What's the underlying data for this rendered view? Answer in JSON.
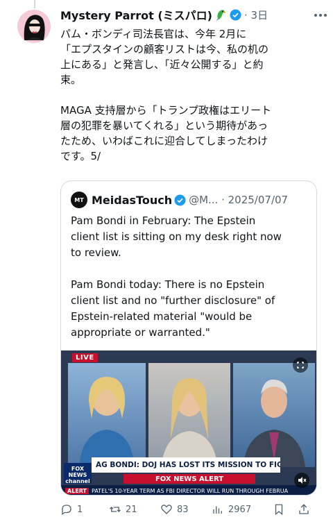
{
  "tweet": {
    "display_name": "Mystery Parrot (ミスパロ)",
    "time": "3日",
    "text": "パム・ボンディ司法長官は、今年 2月に\n「エプスタインの顧客リストは今、私の机の\n上にある」と発言し、「近々公開する」と約\n束。\n\nMAGA 支持層から「トランプ政権はエリート\n層の犯罪を暴いてくれる」という期待があっ\nたため、いわばこれに迎合してしまったわけ\nです。5/"
  },
  "quote": {
    "avatar_text": "MT",
    "display_name": "MeidasTouch",
    "meta": "@M... · 2025/07/07",
    "text": "Pam Bondi in February: The Epstein\nclient list is sitting on my desk right now\nto review.\n\nPam Bondi today: There is no Epstein\nclient list and no \"further disclosure\" of\nEpstein-related material \"would be\nappropriate or warranted.\"",
    "video": {
      "live_label": "LIVE",
      "chyron": "AG BONDI: DOJ HAS LOST ITS MISSION TO FIGHT CRIME",
      "alert_bar": "FOX NEWS ALERT",
      "ticker_alert": "ALERT",
      "ticker": "PATEL'S 10-YEAR TERM AS FBI DIRECTOR WILL RUN THROUGH FEBRUA",
      "logo": "FOX NEWS channel"
    }
  },
  "actions": {
    "replies": "1",
    "reposts": "21",
    "likes": "83",
    "views": "2967"
  },
  "colors": {
    "text": "#0f1419",
    "muted": "#536471",
    "verified": "#1d9bf0",
    "border": "#cfd9de",
    "fox_red": "#c8102e",
    "fox_navy": "#0b1f45"
  },
  "icons": [
    "parrot-icon",
    "verified-icon",
    "more-icon",
    "reply-icon",
    "repost-icon",
    "like-icon",
    "views-icon",
    "bookmark-icon",
    "share-icon",
    "expand-icon",
    "mute-icon"
  ]
}
